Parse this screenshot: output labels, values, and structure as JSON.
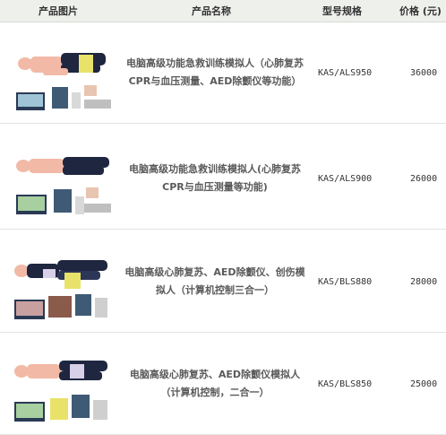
{
  "header": {
    "image_col": "产品图片",
    "name_col": "产品名称",
    "model_col": "型号规格",
    "price_col": "价格 (元)"
  },
  "rows": [
    {
      "name": "电脑高级功能急救训练模拟人（心肺复苏CPR与血压测量、AED除颤仪等功能）",
      "model": "KAS/ALS950",
      "price": "36000"
    },
    {
      "name": "电脑高级功能急救训练模拟人(心肺复苏CPR与血压测量等功能)",
      "model": "KAS/ALS900",
      "price": "26000"
    },
    {
      "name": "电脑高级心肺复苏、AED除颤仪、创伤模拟人（计算机控制三合一）",
      "model": "KAS/BLS880",
      "price": "28000"
    },
    {
      "name": "电脑高级心肺复苏、AED除颤仪模拟人（计算机控制，二合一）",
      "model": "KAS/BLS850",
      "price": "25000"
    }
  ],
  "colors": {
    "header_bg": "#eef0ec",
    "name_text": "#5a5a5a",
    "manikin_skin": "#f2b9a6",
    "manikin_suit": "#1e2640",
    "laptop": "#2a3a55"
  }
}
